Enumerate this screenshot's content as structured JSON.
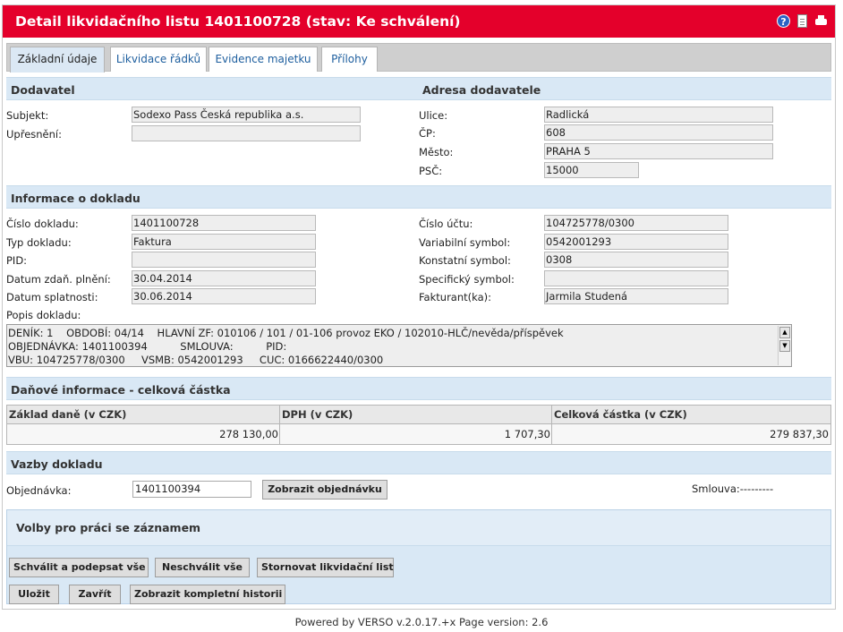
{
  "title": "Detail likvidačního listu 1401100728 (stav: Ke schválení)",
  "icons": [
    "help-icon",
    "document-icon",
    "print-icon"
  ],
  "tabs": [
    {
      "label": "Základní údaje",
      "active": true
    },
    {
      "label": "Likvidace řádků",
      "active": false
    },
    {
      "label": "Evidence majetku",
      "active": false
    },
    {
      "label": "Přílohy",
      "active": false
    }
  ],
  "supplier": {
    "heading": "Dodavatel",
    "subject_label": "Subjekt:",
    "subject_value": "Sodexo Pass Česká republika a.s.",
    "detail_label": "Upřesnění:",
    "detail_value": ""
  },
  "address": {
    "heading": "Adresa dodavatele",
    "street_label": "Ulice:",
    "street_value": "Radlická",
    "cp_label": "ČP:",
    "cp_value": "608",
    "city_label": "Město:",
    "city_value": "PRAHA 5",
    "zip_label": "PSČ:",
    "zip_value": "15000"
  },
  "document": {
    "heading": "Informace o dokladu",
    "number_label": "Číslo dokladu:",
    "number_value": "1401100728",
    "type_label": "Typ dokladu:",
    "type_value": "Faktura",
    "pid_label": "PID:",
    "pid_value": "",
    "tax_date_label": "Datum zdaň. plnění:",
    "tax_date_value": "30.04.2014",
    "due_date_label": "Datum splatnosti:",
    "due_date_value": "30.06.2014",
    "account_label": "Číslo účtu:",
    "account_value": "104725778/0300",
    "vs_label": "Variabilní symbol:",
    "vs_value": "0542001293",
    "ks_label": "Konstatní symbol:",
    "ks_value": "0308",
    "ss_label": "Specifický symbol:",
    "ss_value": "",
    "invoicer_label": "Fakturant(ka):",
    "invoicer_value": "Jarmila Studená",
    "desc_label": "Popis dokladu:",
    "desc_lines": [
      "DENÍK: 1    OBDOBÍ: 04/14    HLAVNÍ ZF: 010106 / 101 / 01-106 provoz EKO / 102010-HLČ/nevěda/příspěvek",
      "OBJEDNÁVKA: 1401100394          SMLOUVA:          PID:",
      "VBU: 104725778/0300     VSMB: 0542001293     CUC: 0166622440/0300"
    ]
  },
  "tax": {
    "heading": "Daňové informace - celková částka",
    "headers": [
      "Základ daně (v CZK)",
      "DPH (v CZK)",
      "Celková částka (v CZK)"
    ],
    "values": [
      "278 130,00",
      "1 707,30",
      "279 837,30"
    ]
  },
  "links": {
    "heading": "Vazby dokladu",
    "order_label": "Objednávka:",
    "order_value": "1401100394",
    "show_order_button": "Zobrazit objednávku",
    "contract_text": "Smlouva:---------"
  },
  "options": {
    "heading": "Volby pro práci se záznamem",
    "buttons_row1": [
      "Schválit a podepsat vše",
      "Neschválit vše",
      "Stornovat likvidační list"
    ],
    "buttons_row2": [
      "Uložit",
      "Zavřít",
      "Zobrazit kompletní historii"
    ]
  },
  "footer": "Powered by VERSO v.2.0.17.+x Page version: 2.6"
}
